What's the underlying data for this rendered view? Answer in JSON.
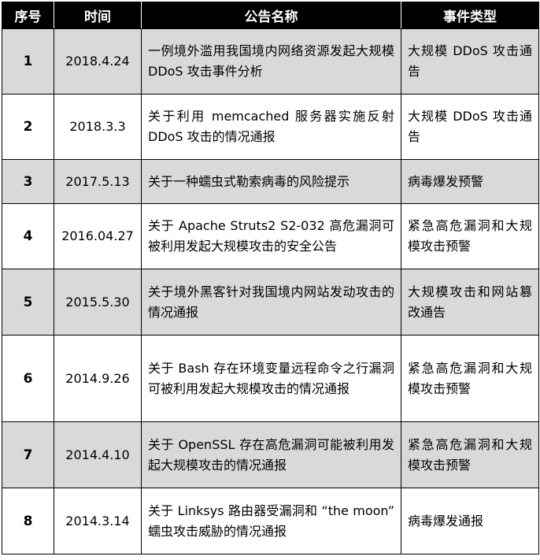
{
  "headers": {
    "no": "序号",
    "date": "时间",
    "title": "公告名称",
    "type": "事件类型"
  },
  "rows": [
    {
      "no": "1",
      "date": "2018.4.24",
      "title": "一例境外滥用我国境内网络资源发起大规模 DDoS 攻击事件分析",
      "type": "大规模 DDoS 攻击通告"
    },
    {
      "no": "2",
      "date": "2018.3.3",
      "title": "关于利用 memcached 服务器实施反射 DDoS 攻击的情况通报",
      "type": "大规模 DDoS 攻击通告"
    },
    {
      "no": "3",
      "date": "2017.5.13",
      "title": "关于一种蠕虫式勒索病毒的风险提示",
      "type": "病毒爆发预警"
    },
    {
      "no": "4",
      "date": "2016.04.27",
      "title": "关于 Apache Struts2 S2-032 高危漏洞可被利用发起大规模攻击的安全公告",
      "type": "紧急高危漏洞和大规模攻击预警"
    },
    {
      "no": "5",
      "date": "2015.5.30",
      "title": "关于境外黑客针对我国境内网站发动攻击的情况通报",
      "type": "大规模攻击和网站篡改通告"
    },
    {
      "no": "6",
      "date": "2014.9.26",
      "title": "关于 Bash 存在环境变量远程命令之行漏洞可被利用发起大规模攻击的情况通报",
      "type": "紧急高危漏洞和大规模攻击预警"
    },
    {
      "no": "7",
      "date": "2014.4.10",
      "title": "关于 OpenSSL 存在高危漏洞可能被利用发起大规模攻击的情况通报",
      "type": "紧急高危漏洞和大规模攻击预警"
    },
    {
      "no": "8",
      "date": "2014.3.14",
      "title": "关于 Linksys 路由器受漏洞和 “the moon” 蠕虫攻击威胁的情况通报",
      "type": "病毒爆发通报"
    }
  ]
}
